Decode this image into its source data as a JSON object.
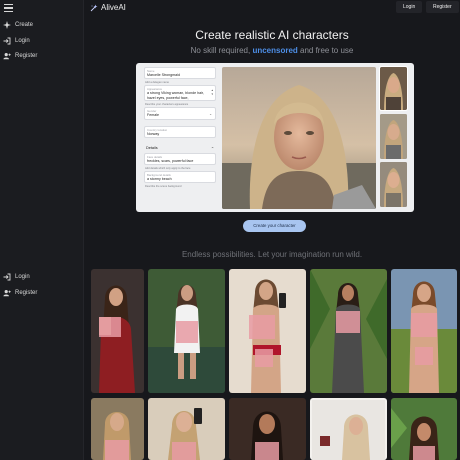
{
  "header": {
    "logo_text": "AliveAI",
    "login_label": "Login",
    "register_label": "Register"
  },
  "sidebar": {
    "items": [
      {
        "label": "Create",
        "icon": "sparkle-icon"
      },
      {
        "label": "Login",
        "icon": "login-icon"
      },
      {
        "label": "Register",
        "icon": "user-plus-icon"
      }
    ],
    "bottom_items": [
      {
        "label": "Login",
        "icon": "login-icon"
      },
      {
        "label": "Register",
        "icon": "user-plus-icon"
      }
    ]
  },
  "hero": {
    "title": "Create realistic AI characters",
    "sub_before": "No skill required, ",
    "sub_accent": "uncensored",
    "sub_after": " and free to use"
  },
  "form": {
    "name_label": "Name",
    "name_value": "Marcelle Strongmaid",
    "name_hint": "Add a delegan name",
    "appearance_label": "Appearance",
    "appearance_value": "a strong Viking woman, blonde hair, hazel eyes, powerful face,",
    "appearance_hint": "Describe your characters appearance",
    "gender_label": "Gender",
    "gender_value": "Female",
    "country_label": "Country location",
    "country_value": "Norway",
    "details_label": "Details",
    "face_label": "Face details",
    "face_value": "freckles, scars, powerful face",
    "face_hint": "Add details which only apply to the face",
    "background_label": "Background details",
    "background_value": "a stormy beach",
    "background_hint": "Describe the scene background"
  },
  "create_button_label": "Create your character",
  "gallery_heading": "Endless possibilities. Let your imagination run wild.",
  "colors": {
    "accent": "#4d8ee6",
    "button_bg": "#a8c5f0",
    "page_bg": "#17181c"
  }
}
